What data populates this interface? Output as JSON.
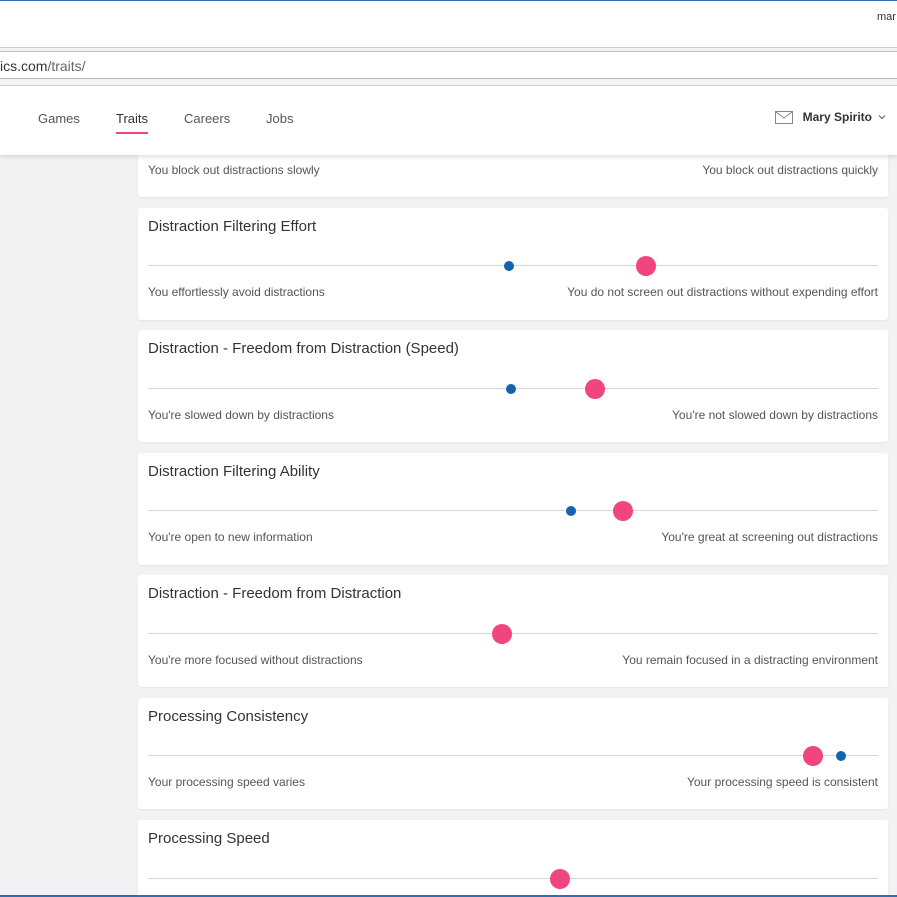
{
  "browser": {
    "user_fragment": "mar",
    "address": {
      "host": "ics.com",
      "path": "/traits/"
    }
  },
  "nav": {
    "items": [
      {
        "label": "Games"
      },
      {
        "label": "Traits"
      },
      {
        "label": "Careers"
      },
      {
        "label": "Jobs"
      }
    ],
    "active": "Traits"
  },
  "user": {
    "name": "Mary Spirito"
  },
  "colors": {
    "accent": "#f0457e",
    "marker": "#1463ac"
  },
  "traits": [
    {
      "title": "",
      "left": "You block out distractions slowly",
      "right": "You block out distractions quickly",
      "score": null,
      "reference": null
    },
    {
      "title": "Distraction Filtering Effort",
      "left": "You effortlessly avoid distractions",
      "right": "You do not screen out distractions without expending effort",
      "score": 0.682,
      "reference": 0.494
    },
    {
      "title": "Distraction - Freedom from Distraction (Speed)",
      "left": "You're slowed down by distractions",
      "right": "You're not slowed down by distractions",
      "score": 0.612,
      "reference": 0.497
    },
    {
      "title": "Distraction Filtering Ability",
      "left": "You're open to new information",
      "right": "You're great at screening out distractions",
      "score": 0.651,
      "reference": 0.579
    },
    {
      "title": "Distraction - Freedom from Distraction",
      "left": "You're more focused without distractions",
      "right": "You remain focused in a distracting environment",
      "score": 0.485,
      "reference": null
    },
    {
      "title": "Processing Consistency",
      "left": "Your processing speed varies",
      "right": "Your processing speed is consistent",
      "score": 0.911,
      "reference": 0.949
    },
    {
      "title": "Processing Speed",
      "left": "",
      "right": "",
      "score": 0.564,
      "reference": null
    }
  ]
}
